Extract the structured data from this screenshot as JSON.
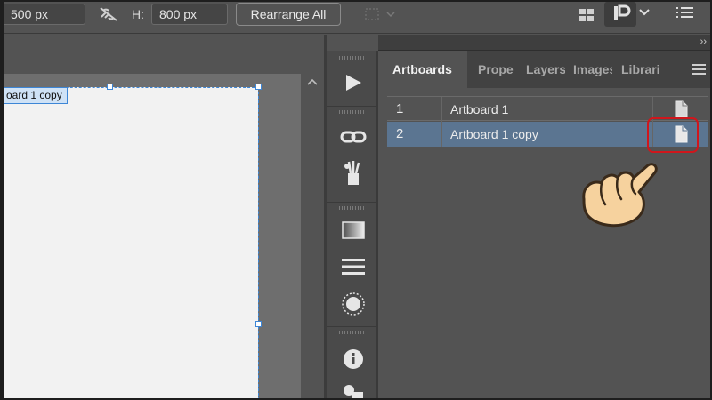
{
  "toolbar": {
    "width_value": "500 px",
    "height_label": "H:",
    "height_value": "800 px",
    "rearrange_label": "Rearrange All"
  },
  "canvas": {
    "artboard_label": "oard 1 copy"
  },
  "panel": {
    "collapse_left": "‹‹",
    "collapse_right": "››",
    "tabs": [
      {
        "label": "Artboards",
        "active": true
      },
      {
        "label": "Prope",
        "active": false
      },
      {
        "label": "Layers",
        "active": false
      },
      {
        "label": "Images",
        "active": false
      },
      {
        "label": "Librari",
        "active": false
      }
    ],
    "rows": [
      {
        "number": "1",
        "name": "Artboard 1",
        "selected": false
      },
      {
        "number": "2",
        "name": "Artboard 1 copy",
        "selected": true
      }
    ]
  },
  "tools": [
    "play-icon",
    "link-icon",
    "brushes-icon",
    "gradient-icon",
    "align-icon",
    "appearance-icon",
    "info-icon",
    "shapes-icon"
  ],
  "colors": {
    "selection": "#3d86d6",
    "selected_row": "#5b7591",
    "highlight": "#d0161c"
  }
}
